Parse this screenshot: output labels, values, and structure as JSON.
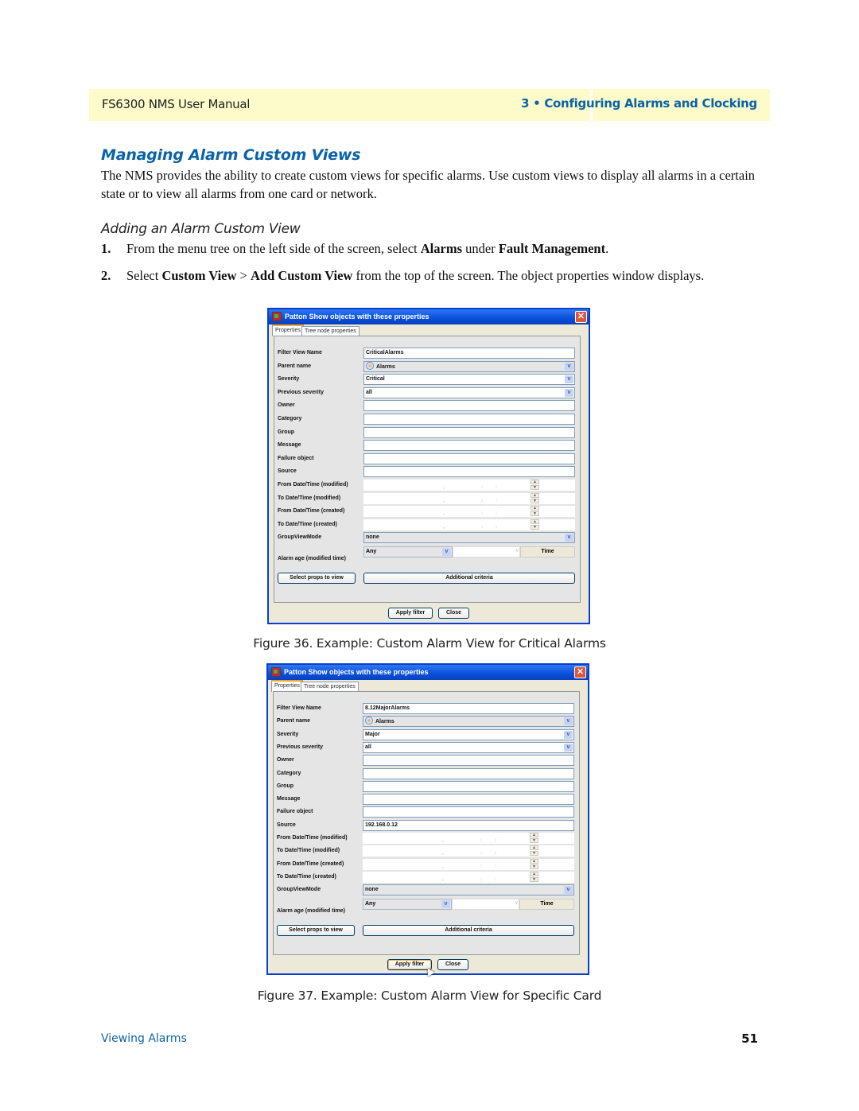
{
  "header": {
    "manual_title": "FS6300 NMS User Manual",
    "chapter": "3 • Configuring Alarms and Clocking"
  },
  "section": {
    "title": "Managing Alarm Custom Views",
    "intro": "The NMS provides the ability to create custom views for specific alarms. Use custom views to display all alarms in a certain state or to view all alarms from one card or network.",
    "subsection_title": "Adding an Alarm Custom View",
    "steps": [
      {
        "num": "1.",
        "parts": [
          "From the menu tree on the left side of the screen, select ",
          "Alarms",
          " under ",
          "Fault Management",
          "."
        ]
      },
      {
        "num": "2.",
        "parts": [
          "Select ",
          "Custom View",
          " > ",
          "Add Custom View",
          " from the top of the screen. The object properties window displays."
        ]
      }
    ]
  },
  "dialog_common": {
    "window_title": "Patton  Show objects with these properties",
    "close_glyph": "✕",
    "tabs": [
      "Properties",
      "Tree node properties"
    ],
    "labels": {
      "filter_view_name": "Filter View Name",
      "parent_name": "Parent name",
      "severity": "Severity",
      "previous_severity": "Previous severity",
      "owner": "Owner",
      "category": "Category",
      "group": "Group",
      "message": "Message",
      "failure_object": "Failure object",
      "source": "Source",
      "from_modified": "From Date/Time (modified)",
      "to_modified": "To Date/Time (modified)",
      "from_created": "From Date/Time (created)",
      "to_created": "To Date/Time (created)",
      "group_view_mode": "GroupViewMode",
      "alarm_age": "Alarm age (modified time)"
    },
    "dropdown_arrow": "v",
    "spin_up": "▲",
    "spin_down": "▼",
    "date_separators": [
      ",",
      ":",
      ":"
    ],
    "alarm_age_any": "Any",
    "time_button": "Time",
    "select_props_button": "Select props to view",
    "additional_criteria_button": "Additional criteria",
    "apply_filter_button": "Apply filter",
    "close_button": "Close",
    "parent_icon": "alarm-bell-icon"
  },
  "figures": [
    {
      "caption": "Figure 36. Example: Custom Alarm View for Critical Alarms",
      "values": {
        "filter_view_name": "CriticalAlarms",
        "parent_name": "Alarms",
        "severity": "Critical",
        "previous_severity": "all",
        "owner": "",
        "category": "",
        "group": "",
        "message": "",
        "failure_object": "",
        "source": "",
        "group_view_mode": "none"
      }
    },
    {
      "caption": "Figure 37. Example: Custom Alarm View for Specific Card",
      "values": {
        "filter_view_name": "8.12MajorAlarms",
        "parent_name": "Alarms",
        "severity": "Major",
        "previous_severity": "all",
        "owner": "",
        "category": "",
        "group": "",
        "message": "",
        "failure_object": "",
        "source": "192.168.0.12",
        "group_view_mode": "none"
      }
    }
  ],
  "footer": {
    "section_name": "Viewing Alarms",
    "page_number": "51"
  }
}
